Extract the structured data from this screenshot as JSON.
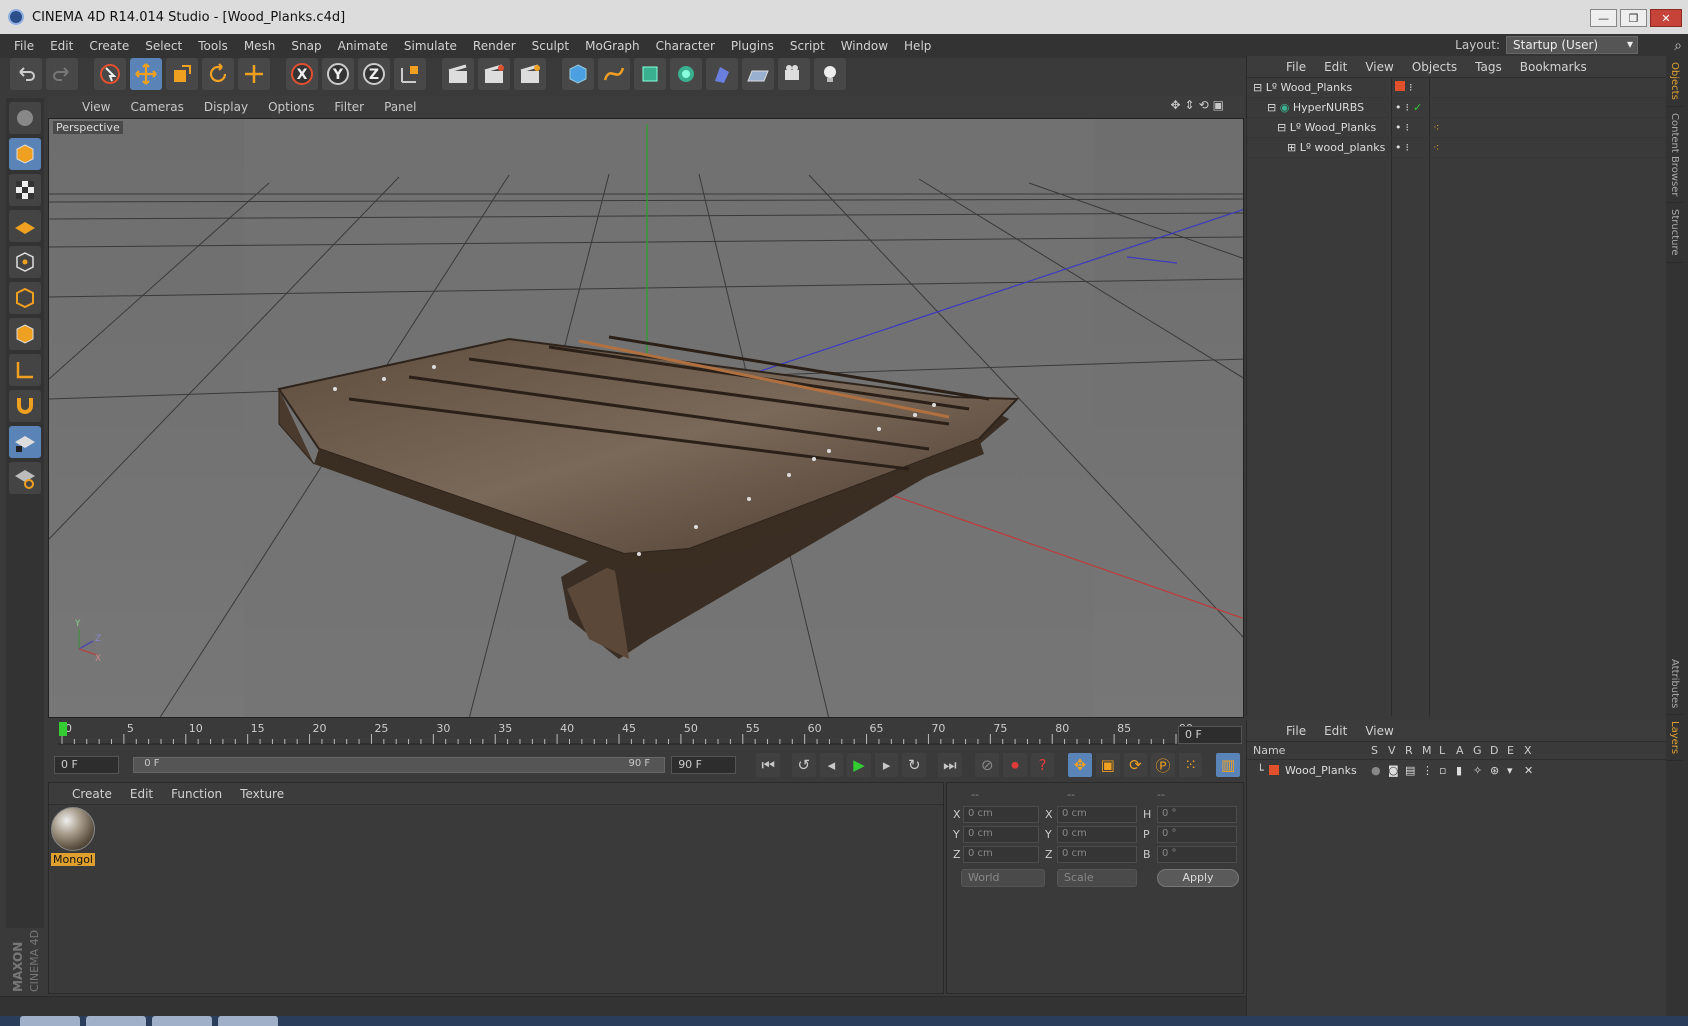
{
  "window": {
    "title": "CINEMA 4D R14.014 Studio - [Wood_Planks.c4d]",
    "minimize": "—",
    "restore": "❐",
    "close": "✕"
  },
  "menubar": [
    "File",
    "Edit",
    "Create",
    "Select",
    "Tools",
    "Mesh",
    "Snap",
    "Animate",
    "Simulate",
    "Render",
    "Sculpt",
    "MoGraph",
    "Character",
    "Plugins",
    "Script",
    "Window",
    "Help"
  ],
  "layout": {
    "label": "Layout:",
    "value": "Startup (User)"
  },
  "toolbar": {
    "axis_x": "X",
    "axis_y": "Y",
    "axis_z": "Z"
  },
  "viewport": {
    "menu": [
      "View",
      "Cameras",
      "Display",
      "Options",
      "Filter",
      "Panel"
    ],
    "label": "Perspective",
    "axis_y": "Y",
    "axis_z": "Z",
    "axis_x": "X"
  },
  "objects": {
    "menu": [
      "File",
      "Edit",
      "View",
      "Objects",
      "Tags",
      "Bookmarks"
    ],
    "tree": [
      {
        "name": "Wood_Planks",
        "level": 0
      },
      {
        "name": "HyperNURBS",
        "level": 1
      },
      {
        "name": "Wood_Planks",
        "level": 2
      },
      {
        "name": "wood_planks",
        "level": 3
      }
    ]
  },
  "side_tabs": [
    "Objects",
    "Content Browser",
    "Structure"
  ],
  "side_tabs_lower": [
    "Attributes",
    "Layers"
  ],
  "timeline": {
    "ticks": [
      "0",
      "5",
      "10",
      "15",
      "20",
      "25",
      "30",
      "35",
      "40",
      "45",
      "50",
      "55",
      "60",
      "65",
      "70",
      "75",
      "80",
      "85",
      "90"
    ],
    "current_frame": "0 F",
    "start": "0 F",
    "range_start": "0 F",
    "range_end": "90 F",
    "end": "90 F"
  },
  "materials": {
    "menu": [
      "Create",
      "Edit",
      "Function",
      "Texture"
    ],
    "items": [
      {
        "name": "Mongol"
      }
    ]
  },
  "coords": {
    "headers": [
      "--",
      "--",
      "--"
    ],
    "rows": [
      {
        "l1": "X",
        "v1": "0 cm",
        "l2": "X",
        "v2": "0 cm",
        "l3": "H",
        "v3": "0 °"
      },
      {
        "l1": "Y",
        "v1": "0 cm",
        "l2": "Y",
        "v2": "0 cm",
        "l3": "P",
        "v3": "0 °"
      },
      {
        "l1": "Z",
        "v1": "0 cm",
        "l2": "Z",
        "v2": "0 cm",
        "l3": "B",
        "v3": "0 °"
      }
    ],
    "mode1": "World",
    "mode2": "Scale",
    "apply": "Apply"
  },
  "layers": {
    "menu": [
      "File",
      "Edit",
      "View"
    ],
    "columns": [
      "Name",
      "S",
      "V",
      "R",
      "M",
      "L",
      "A",
      "G",
      "D",
      "E",
      "X"
    ],
    "rows": [
      {
        "name": "Wood_Planks",
        "color": "#e0502a"
      }
    ]
  },
  "logo": {
    "brand": "MAXON",
    "product": "CINEMA 4D"
  },
  "colors": {
    "accent": "#5a84b8",
    "highlight": "#e0a030"
  }
}
